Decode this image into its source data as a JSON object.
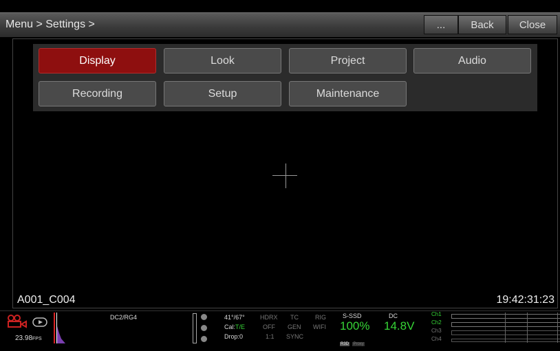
{
  "header": {
    "breadcrumb": "Menu > Settings >",
    "more_label": "...",
    "back_label": "Back",
    "close_label": "Close"
  },
  "tabs": [
    {
      "label": "Display",
      "active": true
    },
    {
      "label": "Look"
    },
    {
      "label": "Project"
    },
    {
      "label": "Audio"
    },
    {
      "label": "Recording"
    },
    {
      "label": "Setup"
    },
    {
      "label": "Maintenance"
    }
  ],
  "overlay": {
    "clip_name": "A001_C004",
    "timecode": "19:42:31:23"
  },
  "status": {
    "fps": "23.98",
    "fps_unit": "FPS",
    "color": "DC2/RG4",
    "temps": "41°/67°",
    "cal_label": "Cal:",
    "cal_value": "T/E",
    "drop": "Drop:0",
    "hdrx": "HDRX",
    "hdrx_val": "OFF",
    "hdrx_ratio": "1:1",
    "tc": "TC",
    "tc_val": "GEN",
    "tc_sync": "SYNC",
    "rig": "RIG",
    "wifi": "WIFI",
    "media_label": "S-SSD",
    "media_value": "100%",
    "r3d": "R3D",
    "proxy": "Proxy",
    "power_label": "DC",
    "power_value": "14.8V",
    "channels": [
      "Ch1",
      "Ch2",
      "Ch3",
      "Ch4"
    ],
    "colors": {
      "accent_red": "#8e0f0f",
      "green": "#36d436"
    }
  }
}
